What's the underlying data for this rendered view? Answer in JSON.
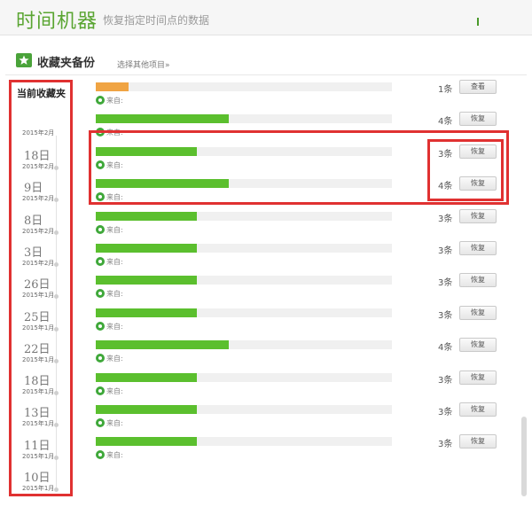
{
  "header": {
    "title": "时间机器",
    "subtitle": "恢复指定时间点的数据"
  },
  "section": {
    "title": "收藏夹备份",
    "link": "选择其他项目»"
  },
  "timeline": {
    "current_label": "当前收藏夹",
    "top_month": "2015年2月",
    "entries": [
      {
        "day": "18日",
        "month": "2015年2月"
      },
      {
        "day": "9日",
        "month": "2015年2月"
      },
      {
        "day": "8日",
        "month": "2015年2月"
      },
      {
        "day": "3日",
        "month": "2015年2月"
      },
      {
        "day": "26日",
        "month": "2015年1月"
      },
      {
        "day": "25日",
        "month": "2015年1月"
      },
      {
        "day": "22日",
        "month": "2015年1月"
      },
      {
        "day": "18日",
        "month": "2015年1月"
      },
      {
        "day": "13日",
        "month": "2015年1月"
      },
      {
        "day": "11日",
        "month": "2015年1月"
      },
      {
        "day": "10日",
        "month": "2015年1月"
      }
    ]
  },
  "colors": {
    "bar_green": "#5bbf2e",
    "bar_orange": "#f0a443",
    "highlight": "#e03131",
    "brand": "#5aa532"
  },
  "rows": [
    {
      "count": "1条",
      "button": "查看",
      "source": "来自:",
      "fill_pct": 11,
      "color": "orange"
    },
    {
      "count": "4条",
      "button": "恢复",
      "source": "来自:",
      "fill_pct": 45,
      "color": "green"
    },
    {
      "count": "3条",
      "button": "恢复",
      "source": "来自:",
      "fill_pct": 34,
      "color": "green"
    },
    {
      "count": "4条",
      "button": "恢复",
      "source": "来自:",
      "fill_pct": 45,
      "color": "green"
    },
    {
      "count": "3条",
      "button": "恢复",
      "source": "来自:",
      "fill_pct": 34,
      "color": "green"
    },
    {
      "count": "3条",
      "button": "恢复",
      "source": "来自:",
      "fill_pct": 34,
      "color": "green"
    },
    {
      "count": "3条",
      "button": "恢复",
      "source": "来自:",
      "fill_pct": 34,
      "color": "green"
    },
    {
      "count": "3条",
      "button": "恢复",
      "source": "来自:",
      "fill_pct": 34,
      "color": "green"
    },
    {
      "count": "4条",
      "button": "恢复",
      "source": "来自:",
      "fill_pct": 45,
      "color": "green"
    },
    {
      "count": "3条",
      "button": "恢复",
      "source": "来自:",
      "fill_pct": 34,
      "color": "green"
    },
    {
      "count": "3条",
      "button": "恢复",
      "source": "来自:",
      "fill_pct": 34,
      "color": "green"
    },
    {
      "count": "3条",
      "button": "恢复",
      "source": "来自:",
      "fill_pct": 34,
      "color": "green"
    }
  ]
}
